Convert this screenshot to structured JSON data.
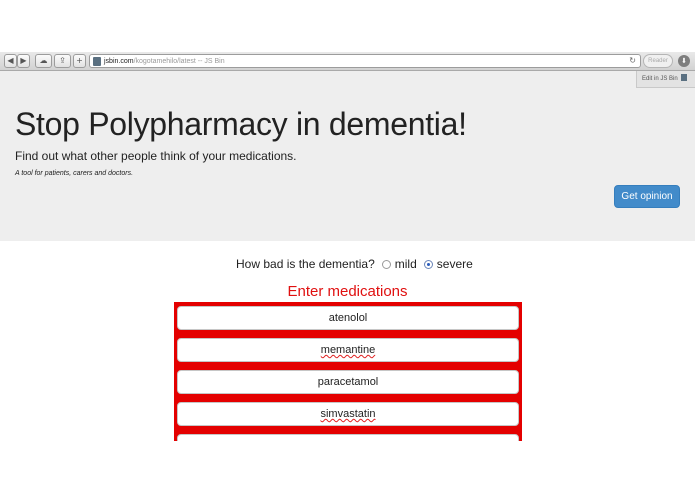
{
  "browser": {
    "url_host": "jsbin.com",
    "url_path": "/kogotamehilo/latest -- JS Bin",
    "reader_label": "Reader",
    "back_glyph": "◀",
    "forward_glyph": "▶",
    "cloud_glyph": "☁",
    "share_glyph": "⇪",
    "new_tab_glyph": "+",
    "reload_glyph": "↻",
    "download_glyph": "⬇"
  },
  "jsbin": {
    "edit_label": "Edit in JS Bin"
  },
  "page": {
    "title": "Stop Polypharmacy in dementia!",
    "subtitle": "Find out what other people think of your medications.",
    "tagline": "A tool for patients, carers and doctors.",
    "opinion_button": "Get opinion",
    "question": "How bad is the dementia?",
    "severity_options": [
      {
        "label": "mild",
        "checked": false
      },
      {
        "label": "severe",
        "checked": true
      }
    ],
    "medications_heading": "Enter medications",
    "medications": [
      "atenolol",
      "memantine",
      "paracetamol",
      "simvastatin",
      ""
    ],
    "accent_red": "#e40000",
    "button_blue": "#428bca"
  }
}
